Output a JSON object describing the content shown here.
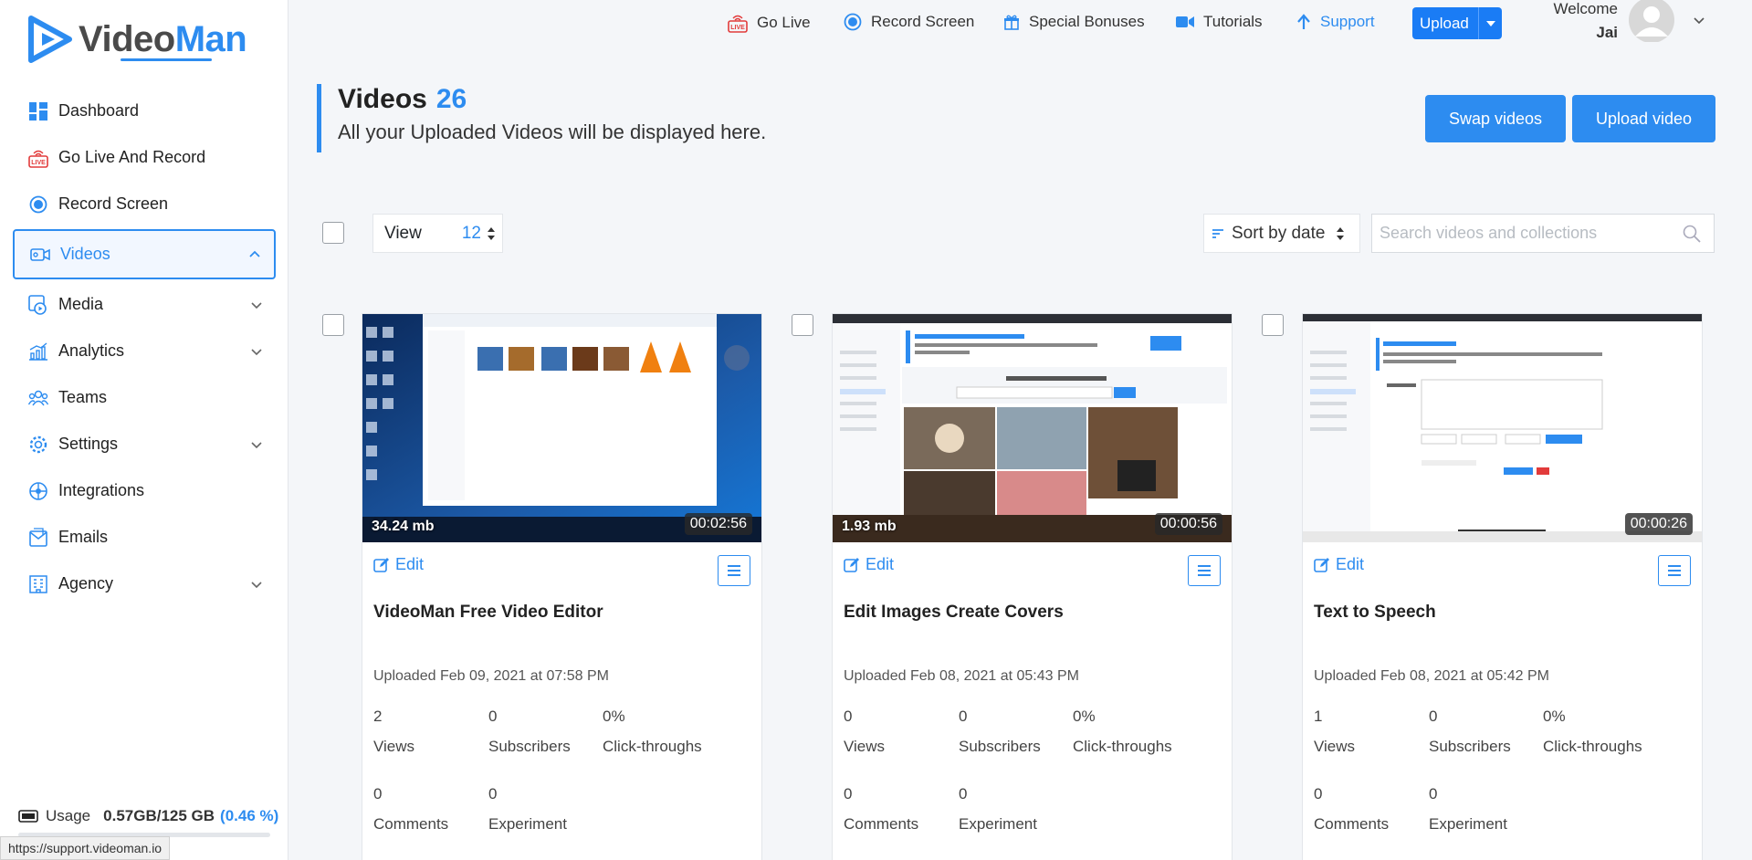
{
  "brand": {
    "name_left": "Video",
    "name_right": "Man",
    "accent": "#2d8cf0"
  },
  "sidebar": {
    "items": [
      {
        "label": "Dashboard",
        "icon": "dashboard-icon"
      },
      {
        "label": "Go Live And Record",
        "icon": "live-icon"
      },
      {
        "label": "Record Screen",
        "icon": "record-icon"
      },
      {
        "label": "Videos",
        "icon": "video-icon",
        "active": true
      },
      {
        "label": "Media",
        "icon": "media-icon"
      },
      {
        "label": "Analytics",
        "icon": "analytics-icon"
      },
      {
        "label": "Teams",
        "icon": "teams-icon"
      },
      {
        "label": "Settings",
        "icon": "settings-icon"
      },
      {
        "label": "Integrations",
        "icon": "integrations-icon"
      },
      {
        "label": "Emails",
        "icon": "emails-icon"
      },
      {
        "label": "Agency",
        "icon": "agency-icon"
      }
    ],
    "usage": {
      "label": "Usage",
      "value": "0.57GB/125 GB",
      "percent": "(0.46 %)"
    }
  },
  "topbar": {
    "go_live": "Go Live",
    "record_screen": "Record Screen",
    "special_bonuses": "Special Bonuses",
    "tutorials": "Tutorials",
    "support": "Support",
    "upload": "Upload",
    "welcome": "Welcome",
    "user_name": "Jai"
  },
  "header": {
    "title": "Videos",
    "count": "26",
    "subtitle": "All your Uploaded Videos will be displayed here.",
    "swap_button": "Swap videos",
    "upload_button": "Upload video"
  },
  "toolbar": {
    "view_label": "View",
    "view_count": "12",
    "sort_label": "Sort by date",
    "search_placeholder": "Search videos and collections"
  },
  "stat_labels": {
    "views": "Views",
    "subscribers": "Subscribers",
    "clicks": "Click-throughs",
    "comments": "Comments",
    "experiment": "Experiment"
  },
  "edit_label": "Edit",
  "videos": [
    {
      "title": "VideoMan Free Video Editor",
      "size": "34.24 mb",
      "duration": "00:02:56",
      "uploaded": "Uploaded Feb 09, 2021 at 07:58 PM",
      "views": "2",
      "subscribers": "0",
      "clicks": "0%",
      "comments": "0",
      "experiment": "0"
    },
    {
      "title": "Edit Images Create Covers",
      "size": "1.93 mb",
      "duration": "00:00:56",
      "uploaded": "Uploaded Feb 08, 2021 at 05:43 PM",
      "views": "0",
      "subscribers": "0",
      "clicks": "0%",
      "comments": "0",
      "experiment": "0"
    },
    {
      "title": "Text to Speech",
      "size": "",
      "duration": "00:00:26",
      "uploaded": "Uploaded Feb 08, 2021 at 05:42 PM",
      "views": "1",
      "subscribers": "0",
      "clicks": "0%",
      "comments": "0",
      "experiment": "0"
    }
  ],
  "status_url": "https://support.videoman.io"
}
